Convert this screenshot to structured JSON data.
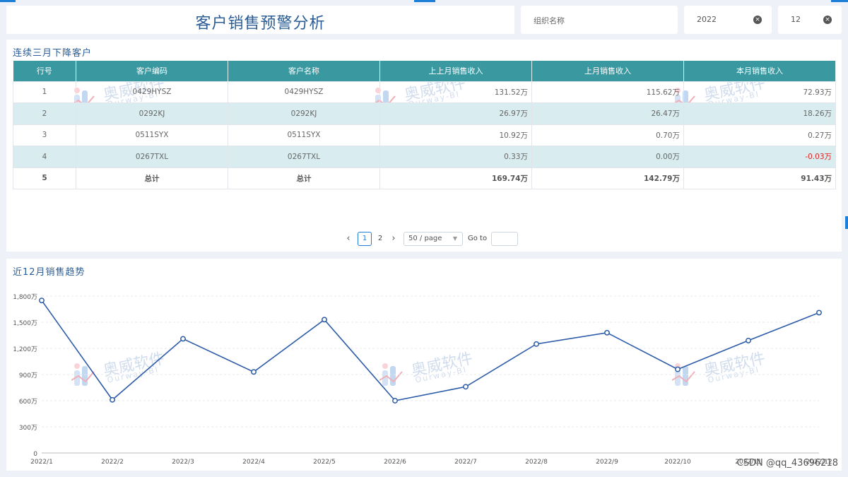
{
  "header": {
    "title": "客户销售预警分析",
    "org_placeholder": "组织名称",
    "year": "2022",
    "month": "12"
  },
  "table": {
    "section_title": "连续三月下降客户",
    "columns": [
      "行号",
      "客户编码",
      "客户名称",
      "上上月销售收入",
      "上月销售收入",
      "本月销售收入"
    ],
    "rows": [
      [
        "1",
        "0429HYSZ",
        "0429HYSZ",
        "131.52万",
        "115.62万",
        "72.93万"
      ],
      [
        "2",
        "0292KJ",
        "0292KJ",
        "26.97万",
        "26.47万",
        "18.26万"
      ],
      [
        "3",
        "0511SYX",
        "0511SYX",
        "10.92万",
        "0.70万",
        "0.27万"
      ],
      [
        "4",
        "0267TXL",
        "0267TXL",
        "0.33万",
        "0.00万",
        "-0.03万"
      ],
      [
        "5",
        "总计",
        "总计",
        "169.74万",
        "142.79万",
        "91.43万"
      ]
    ]
  },
  "pager": {
    "prev": "‹",
    "pages": [
      "1",
      "2"
    ],
    "current": "1",
    "next": "›",
    "page_size": "50 / page",
    "goto_label": "Go to"
  },
  "watermark": {
    "cn": "奥威软件",
    "en": "Ourway-BI"
  },
  "credit": "CSDN @qq_43696218",
  "colors": {
    "accent": "#1e7fd8",
    "title": "#2b5d96",
    "table_header": "#3a98a0",
    "row_alt": "#d9edf0",
    "line": "#2d5ca8",
    "negative": "#dd2222"
  },
  "chart_data": {
    "type": "line",
    "title": "近12月销售趋势",
    "categories": [
      "2022/1",
      "2022/2",
      "2022/3",
      "2022/4",
      "2022/5",
      "2022/6",
      "2022/7",
      "2022/8",
      "2022/9",
      "2022/10",
      "2022/11",
      "2022/12"
    ],
    "values": [
      1750,
      610,
      1310,
      930,
      1530,
      600,
      760,
      1250,
      1380,
      960,
      1290,
      1610
    ],
    "y_unit": "万",
    "ylim": [
      0,
      1800
    ],
    "yticks": [
      "0",
      "300万",
      "600万",
      "900万",
      "1,200万",
      "1,500万",
      "1,800万"
    ],
    "ytick_values": [
      0,
      300,
      600,
      900,
      1200,
      1500,
      1800
    ],
    "grid": true,
    "legend": "none"
  }
}
